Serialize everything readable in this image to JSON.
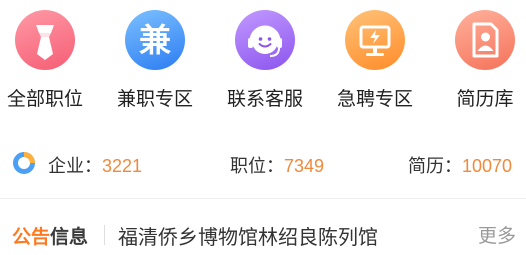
{
  "menu": {
    "items": [
      {
        "label": "全部职位",
        "icon": "necktie-icon",
        "color": "#f55d74"
      },
      {
        "label": "兼职专区",
        "icon": "jian-character-icon",
        "glyph": "兼",
        "color": "#2c7cf2"
      },
      {
        "label": "联系客服",
        "icon": "headset-smiley-icon",
        "color": "#8c55ee"
      },
      {
        "label": "急聘专区",
        "icon": "monitor-lightning-icon",
        "color": "#ff8c2a"
      },
      {
        "label": "简历库",
        "icon": "resume-document-icon",
        "color": "#f5725a"
      }
    ]
  },
  "stats": {
    "icon": "ring-chart-icon",
    "companies": {
      "label": "企业：",
      "value": "3221"
    },
    "jobs": {
      "label": "职位：",
      "value": "7349"
    },
    "resumes": {
      "label": "简历：",
      "value": "10070"
    },
    "value_color": "#ef8a3c"
  },
  "notice": {
    "brand_part1": "公告",
    "brand_part2": "信息",
    "text": "福清侨乡博物馆林绍良陈列馆",
    "more": "更多"
  }
}
